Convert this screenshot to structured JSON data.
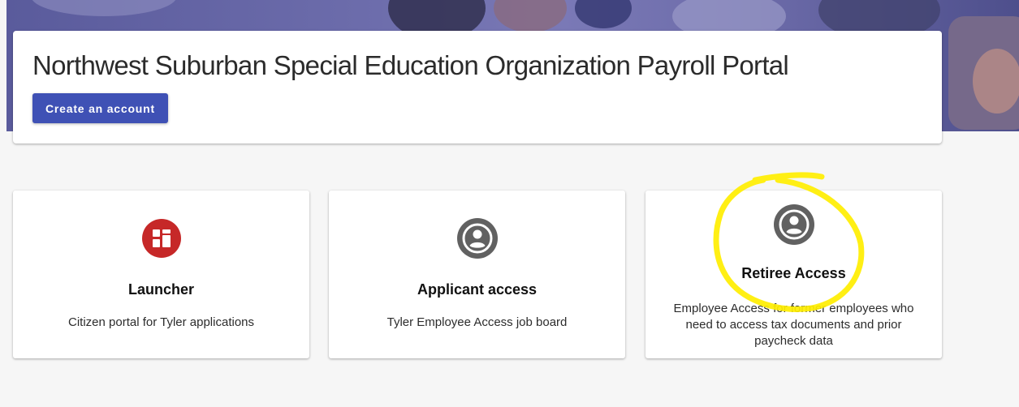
{
  "header": {
    "title": "Northwest Suburban Special Education Organization Payroll Portal",
    "create_account_label": "Create an account",
    "accent_color": "#3f51b5"
  },
  "tiles": [
    {
      "name": "Launcher",
      "description": "Citizen portal for Tyler applications",
      "icon": "launcher-grid-icon",
      "icon_color": "#c62828"
    },
    {
      "name": "Applicant access",
      "description": "Tyler Employee Access job board",
      "icon": "account-circle-icon",
      "icon_color": "#616161"
    },
    {
      "name": "Retiree Access",
      "description": "Employee Access for former employees who need to access tax documents and prior paycheck data",
      "icon": "account-circle-icon",
      "icon_color": "#616161"
    }
  ],
  "annotation": {
    "shape": "hand-drawn circle",
    "target": "Retiree Access",
    "color": "#ffee00"
  }
}
